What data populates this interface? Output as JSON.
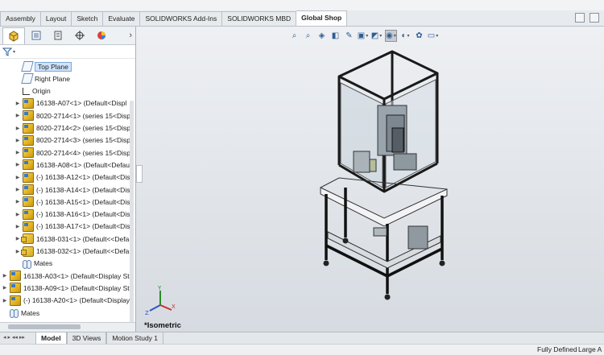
{
  "command_tabs": [
    "Assembly",
    "Layout",
    "Sketch",
    "Evaluate",
    "SOLIDWORKS Add-Ins",
    "SOLIDWORKS MBD",
    "Global Shop"
  ],
  "active_command_tab": "Global Shop",
  "tree": {
    "items": [
      {
        "label": "Top Plane",
        "icon": "plane-icon",
        "selected": true
      },
      {
        "label": "Right Plane",
        "icon": "plane-icon"
      },
      {
        "label": "Origin",
        "icon": "origin-icon"
      },
      {
        "label": "16138-A07<1> (Default<Displ",
        "icon": "part-icon"
      },
      {
        "label": "8020-2714<1> (series 15<Displ",
        "icon": "part-icon"
      },
      {
        "label": "8020-2714<2> (series 15<Displ",
        "icon": "part-icon"
      },
      {
        "label": "8020-2714<3> (series 15<Displ",
        "icon": "part-icon"
      },
      {
        "label": "8020-2714<4> (series 15<Displ",
        "icon": "part-icon"
      },
      {
        "label": "16138-A08<1> (Default<Defau",
        "icon": "part-icon"
      },
      {
        "label": "(-) 16138-A12<1> (Default<Dis",
        "icon": "part-icon"
      },
      {
        "label": "(-) 16138-A14<1> (Default<Dis",
        "icon": "part-icon"
      },
      {
        "label": "(-) 16138-A15<1> (Default<Dis",
        "icon": "part-icon"
      },
      {
        "label": "(-) 16138-A16<1> (Default<Dis",
        "icon": "part-icon"
      },
      {
        "label": "(-) 16138-A17<1> (Default<Dis",
        "icon": "part-icon"
      },
      {
        "label": "16138-031<1> (Default<<Defa",
        "icon": "assembly-icon"
      },
      {
        "label": "16138-032<1> (Default<<Defa",
        "icon": "assembly-icon"
      },
      {
        "label": "Mates",
        "icon": "mates-icon"
      },
      {
        "label": "16138-A03<1> (Default<Display St",
        "icon": "part-icon"
      },
      {
        "label": "16138-A09<1> (Default<Display St",
        "icon": "part-icon"
      },
      {
        "label": "(-) 16138-A20<1> (Default<Display",
        "icon": "part-icon"
      },
      {
        "label": "Mates",
        "icon": "mates-icon"
      }
    ]
  },
  "viewport": {
    "view_label": "*Isometric",
    "triad_axes": [
      "Y",
      "X",
      "Z"
    ]
  },
  "bottom_tabs": [
    "Model",
    "3D Views",
    "Motion Study 1"
  ],
  "active_bottom_tab": "Model",
  "status": {
    "definition": "Fully Defined",
    "units": "Large A"
  }
}
